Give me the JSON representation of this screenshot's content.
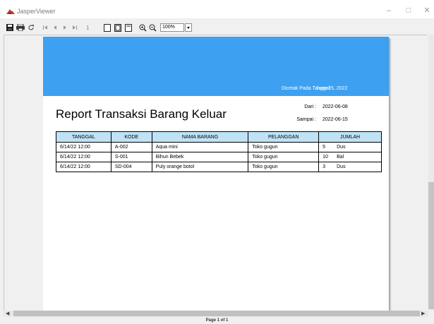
{
  "window": {
    "title": "JasperViewer",
    "min": "–",
    "max": "□",
    "close": "✕"
  },
  "toolbar": {
    "page_number": "1",
    "zoom": "100%"
  },
  "header": {
    "printed_label": "Dicetak Pada Tanggal:",
    "printed_date": "June 15, 2022"
  },
  "report": {
    "title": "Report Transaksi Barang Keluar",
    "dari_label": "Dari :",
    "dari_value": "2022-06-08",
    "sampai_label": "Sampai :",
    "sampai_value": "2022-06-15"
  },
  "table": {
    "columns": [
      "TANGGAL",
      "KODE",
      "NAMA BARANG",
      "PELANGGAN",
      "JUMLAH"
    ],
    "rows": [
      {
        "tanggal": "6/14/22 12:00",
        "kode": "A-002",
        "nama": "Aqua mini",
        "pelanggan": "Toko gugun",
        "qty": "5",
        "unit": "Dus"
      },
      {
        "tanggal": "6/14/22 12:00",
        "kode": "S-001",
        "nama": "Bihun Bebek",
        "pelanggan": "Toko gugun",
        "qty": "10",
        "unit": "Bal"
      },
      {
        "tanggal": "6/14/22 12:00",
        "kode": "SD-004",
        "nama": "Puly orange botol",
        "pelanggan": "Toko gugun",
        "qty": "3",
        "unit": "Dus"
      }
    ]
  },
  "status": {
    "page_info": "Page 1 of 1"
  },
  "colors": {
    "header_band": "#3ea0f0",
    "table_header": "#bfe2f5"
  },
  "icons": [
    "jasper-logo-icon",
    "save-icon",
    "print-icon",
    "reload-icon",
    "first-page-icon",
    "previous-page-icon",
    "next-page-icon",
    "last-page-icon",
    "actual-size-icon",
    "fit-page-icon",
    "fit-width-icon",
    "zoom-in-icon",
    "zoom-out-icon"
  ]
}
